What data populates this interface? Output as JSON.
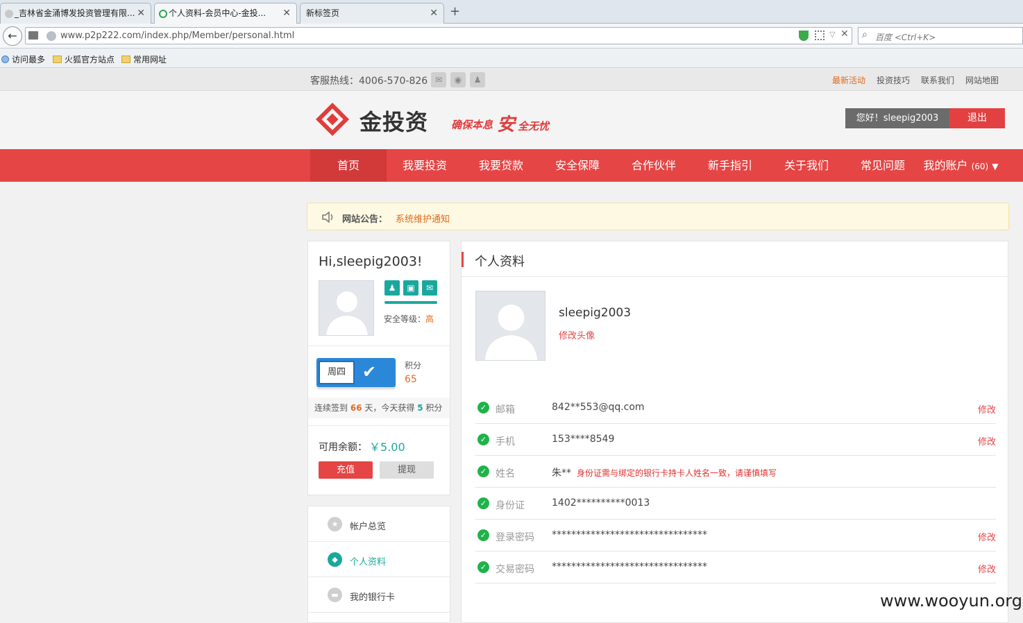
{
  "browser": {
    "tabs": [
      {
        "label": "_吉林省金涌博发投资管理有限..."
      },
      {
        "label": "个人资料-会员中心-金投..."
      },
      {
        "label": "新标签页"
      }
    ],
    "url": "www.p2p222.com/index.php/Member/personal.html",
    "search_placeholder": "百度 <Ctrl+K>",
    "bookmarks": [
      "访问最多",
      "火狐官方站点",
      "常用网址"
    ]
  },
  "topbar": {
    "hotline": "客服热线：4006-570-826",
    "links": [
      "最新活动",
      "投资技巧",
      "联系我们",
      "网站地图"
    ]
  },
  "header": {
    "logo": "金投资",
    "slogan_a": "确保本息",
    "slogan_big": "安",
    "slogan_b": "全无忧",
    "greeting": "您好！sleepig2003",
    "logout": "退出"
  },
  "nav": {
    "items": [
      "首页",
      "我要投资",
      "我要贷款",
      "安全保障",
      "合作伙伴",
      "新手指引",
      "关于我们",
      "常见问题"
    ],
    "account": "我的账户",
    "account_count": "(60)"
  },
  "notice": {
    "label": "网站公告：",
    "text": "系统维护通知"
  },
  "profile_card": {
    "hi": "Hi,sleepig2003!",
    "security_label": "安全等级：",
    "security_level": "高",
    "weekday": "周四",
    "points_label": "积分",
    "points": "65",
    "streak_a": "连续签到",
    "streak_days": "66",
    "streak_b": "天，今天获得",
    "streak_gain": "5",
    "streak_c": "积分",
    "balance_label": "可用余额：",
    "balance": "￥5.00",
    "recharge": "充值",
    "withdraw": "提现"
  },
  "side_menu": [
    "帐户总览",
    "个人资料",
    "我的银行卡"
  ],
  "personal": {
    "title": "个人资料",
    "username": "sleepig2003",
    "change_avatar": "修改头像",
    "edit": "修改",
    "rows": [
      {
        "key": "邮箱",
        "value": "842**553@qq.com"
      },
      {
        "key": "手机",
        "value": "153****8549"
      },
      {
        "key": "姓名",
        "value": "朱**",
        "note": "身份证需与绑定的银行卡持卡人姓名一致，请谨慎填写"
      },
      {
        "key": "身份证",
        "value": "1402**********0013"
      },
      {
        "key": "登录密码",
        "value": "********************************"
      },
      {
        "key": "交易密码",
        "value": "********************************"
      }
    ]
  },
  "watermark": "www.wooyun.org",
  "colors": {
    "brand_red": "#e54545",
    "teal": "#1aa89e",
    "ok_green": "#21b24b"
  }
}
